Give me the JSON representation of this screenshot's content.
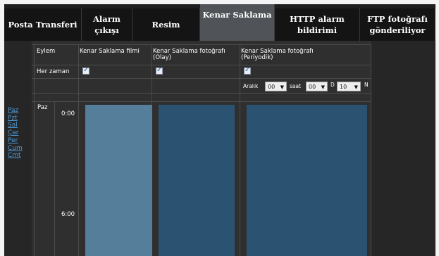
{
  "tabs": [
    {
      "label": "Posta Transferi",
      "active": false
    },
    {
      "label": "Alarm çıkışı",
      "active": false
    },
    {
      "label": "Resim",
      "active": false
    },
    {
      "label": "Kenar Saklama",
      "active": true
    },
    {
      "label": "HTTP alarm bildirimi",
      "active": false
    },
    {
      "label": "FTP fotoğrafı\ngönderiliyor",
      "active": false
    }
  ],
  "days": [
    "Paz",
    "Pzt",
    "Sal",
    "Çar",
    "Per",
    "Cum",
    "Cmt"
  ],
  "grid": {
    "action_label": "Eylem",
    "always_label": "Her zaman",
    "columns": [
      {
        "header": "Kenar Saklama filmi",
        "checked": true
      },
      {
        "header": "Kenar Saklama fotoğrafı\n(Olay)",
        "checked": true
      },
      {
        "header": "Kenar Saklama fotoğrafı\n(Periyodik)",
        "checked": true
      }
    ],
    "interval": {
      "label": "Aralık",
      "value1": "00",
      "saat_label": "saat",
      "value2": "00",
      "d_label": "D",
      "value3": "10",
      "n_label": "N"
    },
    "day_label": "Paz",
    "times": [
      "0:00",
      "6:00"
    ]
  },
  "colors": {
    "block_film": "#557e9a",
    "block_event": "#2c5272",
    "block_periodic": "#2c5272",
    "link": "#4e9bd8"
  }
}
